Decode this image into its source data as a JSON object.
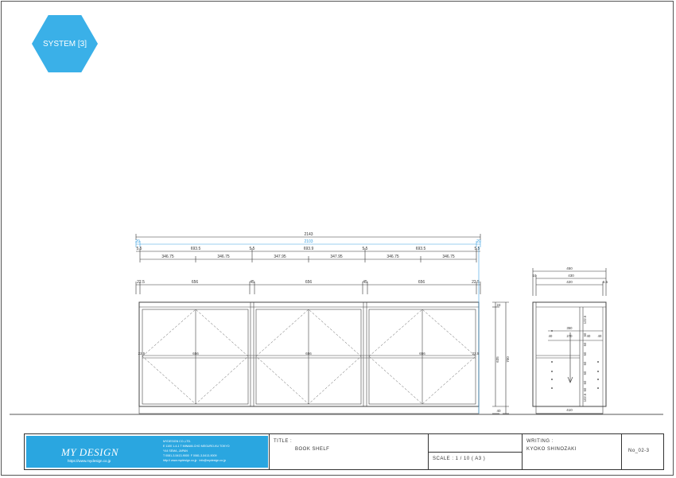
{
  "badge": {
    "label": "SYSTEM [3]",
    "color": "#3ab0e8"
  },
  "front_view": {
    "dims_row1": {
      "total": "2143"
    },
    "dims_row2": {
      "inner": "2103",
      "left": "20",
      "right": "20"
    },
    "dims_row3": [
      "5.5",
      "693.5",
      "5.5",
      "693.9",
      "5.5",
      "693.5",
      "5.5"
    ],
    "dims_row4": [
      "346.75",
      "346.75",
      "347.95",
      "347.95",
      "346.75",
      "346.75"
    ],
    "dims_row5": [
      "22.5",
      "656",
      "45",
      "656",
      "45",
      "656",
      "22.5"
    ],
    "mid_labels": [
      "22.5",
      "656",
      "656",
      "656",
      "22.5"
    ],
    "height_labels": [
      "24",
      "635",
      "700",
      "40"
    ]
  },
  "side_view": {
    "top_dims": [
      "450",
      "430",
      "420",
      "10",
      "6.5"
    ],
    "bottom_dim": "410",
    "inner_dims": [
      "350",
      "40",
      "270",
      "40",
      "40",
      "122.5",
      "60",
      "60",
      "60",
      "60",
      "60",
      "60",
      "60",
      "102.5"
    ]
  },
  "title_block": {
    "company_logo": "MY DESIGN",
    "company_url": "https://www.mydesign.co.jp",
    "company_address": "MYDESIGN CO.,LTD.\nE 1100 1-4-1 T MINAMI-CHO MEGURO-KU TOKYO\nY44 SEMA, JAPAN\nT 0081-3-5413-9000  F 0081-3-5413-9009\nhttp:// www.mydesign.co.jp   info@mydesign.co.jp",
    "title_label": "TITLE :",
    "title_value": "BOOK SHELF",
    "scale_label": "SCALE : 1 / 10 ( A3 )",
    "writing_label": "WRITING :",
    "writing_value": "KYOKO SHINOZAKI",
    "sheet_no": "No_02-3"
  }
}
